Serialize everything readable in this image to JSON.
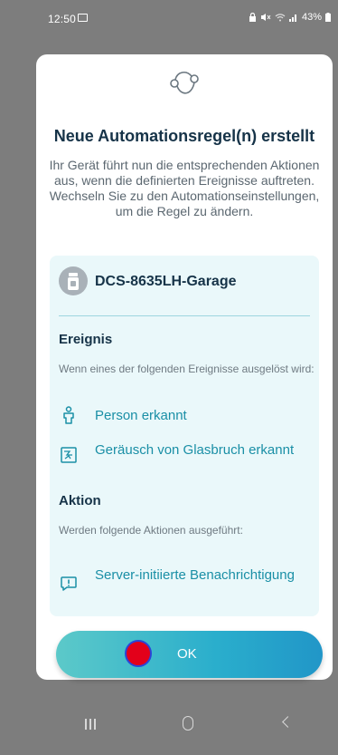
{
  "status_bar": {
    "time": "12:50",
    "battery": "43%",
    "icons": [
      "photo-icon",
      "lock-icon",
      "mute-icon",
      "wifi-icon",
      "signal-icon",
      "battery-icon"
    ]
  },
  "dialog": {
    "header_icon": "automation-icon",
    "title": "Neue Automationsregel(n) erstellt",
    "description": "Ihr Gerät führt nun die entsprechenden Aktionen aus, wenn die definierten Ereignisse auftreten. Wechseln Sie zu den Automationseinstellungen, um die Regel zu ändern.",
    "device": {
      "name": "DCS-8635LH-Garage",
      "icon": "camera-device-icon"
    },
    "event_section": {
      "title": "Ereignis",
      "subtitle": "Wenn eines der folgenden Ereignisse ausgelöst wird:",
      "items": [
        {
          "label": "Person erkannt",
          "icon": "person-icon"
        },
        {
          "label": "Geräusch von Glasbruch erkannt",
          "icon": "glass-break-icon"
        }
      ]
    },
    "action_section": {
      "title": "Aktion",
      "subtitle": "Werden folgende Aktionen ausgeführt:",
      "items": [
        {
          "label": "Server-initiierte Benachrichtigung",
          "icon": "notification-icon"
        }
      ]
    },
    "ok_label": "OK"
  },
  "nav_bar": {
    "recents": "recents-icon",
    "home": "home-icon",
    "back": "back-icon"
  },
  "colors": {
    "accent": "#1a8fa6",
    "title": "#163348",
    "panel_bg": "#eaf8fa",
    "button_gradient_start": "#5cc9c9",
    "button_gradient_end": "#2196c8",
    "touch_indicator": "#e3001a"
  }
}
